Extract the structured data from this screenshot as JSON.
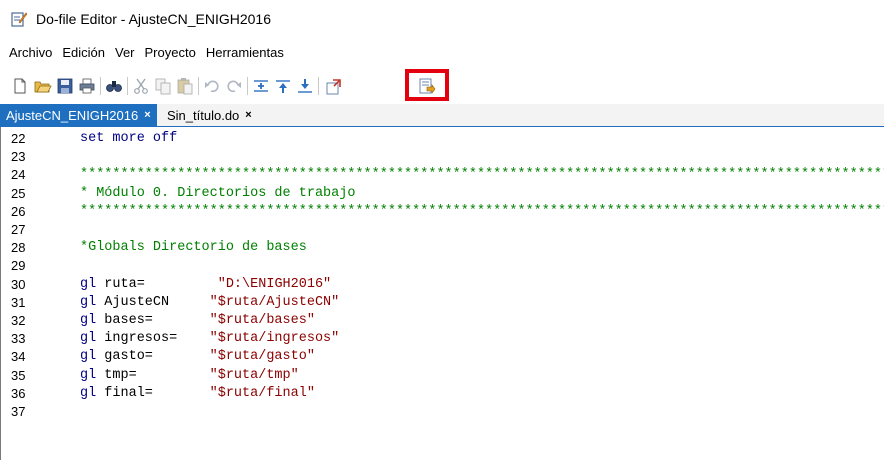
{
  "window": {
    "title": "Do-file Editor - AjusteCN_ENIGH2016"
  },
  "menu": [
    "Archivo",
    "Edición",
    "Ver",
    "Proyecto",
    "Herramientas"
  ],
  "toolbar": {
    "icons": [
      "new-file-icon",
      "open-icon",
      "save-icon",
      "print-icon",
      "find-icon",
      "cut-icon",
      "copy-icon",
      "paste-icon",
      "undo-icon",
      "redo-icon",
      "indent-icon",
      "unindent-icon",
      "bookmark-icon",
      "run-icon",
      "execute-do-icon"
    ],
    "highlight_color": "#e3000f"
  },
  "tabs": [
    {
      "label": "AjusteCN_ENIGH2016",
      "close": "×",
      "active": true
    },
    {
      "label": "Sin_título.do",
      "close": "×",
      "active": false
    }
  ],
  "editor": {
    "lines": [
      {
        "n": "22",
        "parts": [
          {
            "t": "set more off",
            "c": "kw"
          }
        ]
      },
      {
        "n": "23",
        "parts": []
      },
      {
        "n": "24",
        "parts": [
          {
            "t": "****************************************************************************************************",
            "c": "cmt"
          }
        ]
      },
      {
        "n": "25",
        "parts": [
          {
            "t": "* Módulo 0. Directorios de trabajo",
            "c": "cmt"
          }
        ]
      },
      {
        "n": "26",
        "parts": [
          {
            "t": "****************************************************************************************************",
            "c": "cmt"
          }
        ]
      },
      {
        "n": "27",
        "parts": []
      },
      {
        "n": "28",
        "parts": [
          {
            "t": "*Globals Directorio de bases",
            "c": "cmt"
          }
        ]
      },
      {
        "n": "29",
        "parts": []
      },
      {
        "n": "30",
        "parts": [
          {
            "t": "gl",
            "c": "kw"
          },
          {
            "t": " ruta=         ",
            "c": "plain"
          },
          {
            "t": "\"D:\\ENIGH2016\"",
            "c": "str"
          }
        ]
      },
      {
        "n": "31",
        "parts": [
          {
            "t": "gl",
            "c": "kw"
          },
          {
            "t": " AjusteCN     ",
            "c": "plain"
          },
          {
            "t": "\"$ruta/AjusteCN\"",
            "c": "str"
          }
        ]
      },
      {
        "n": "32",
        "parts": [
          {
            "t": "gl",
            "c": "kw"
          },
          {
            "t": " bases=       ",
            "c": "plain"
          },
          {
            "t": "\"$ruta/bases\"",
            "c": "str"
          }
        ]
      },
      {
        "n": "33",
        "parts": [
          {
            "t": "gl",
            "c": "kw"
          },
          {
            "t": " ingresos=    ",
            "c": "plain"
          },
          {
            "t": "\"$ruta/ingresos\"",
            "c": "str"
          }
        ]
      },
      {
        "n": "34",
        "parts": [
          {
            "t": "gl",
            "c": "kw"
          },
          {
            "t": " gasto=       ",
            "c": "plain"
          },
          {
            "t": "\"$ruta/gasto\"",
            "c": "str"
          }
        ]
      },
      {
        "n": "35",
        "parts": [
          {
            "t": "gl",
            "c": "kw"
          },
          {
            "t": " tmp=         ",
            "c": "plain"
          },
          {
            "t": "\"$ruta/tmp\"",
            "c": "str"
          }
        ]
      },
      {
        "n": "36",
        "parts": [
          {
            "t": "gl",
            "c": "kw"
          },
          {
            "t": " final=       ",
            "c": "plain"
          },
          {
            "t": "\"$ruta/final\"",
            "c": "str"
          }
        ]
      },
      {
        "n": "37",
        "parts": []
      }
    ]
  }
}
